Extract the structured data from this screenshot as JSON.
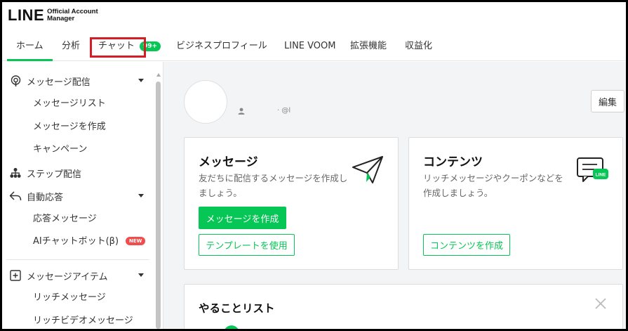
{
  "header": {
    "logo": "LINE",
    "logo_sub_1": "Official Account",
    "logo_sub_2": "Manager"
  },
  "tabs": [
    {
      "label": "ホーム",
      "active": true
    },
    {
      "label": "分析"
    },
    {
      "label": "チャット",
      "badge": "99+"
    },
    {
      "label": "ビジネスプロフィール"
    },
    {
      "label": "LINE VOOM"
    },
    {
      "label": "拡張機能"
    },
    {
      "label": "収益化"
    }
  ],
  "sidebar": {
    "broadcast": {
      "label": "メッセージ配信",
      "items": [
        "メッセージリスト",
        "メッセージを作成",
        "キャンペーン"
      ]
    },
    "step": {
      "label": "ステップ配信"
    },
    "auto_reply": {
      "label": "自動応答",
      "items": [
        "応答メッセージ",
        "AIチャットボット(β)"
      ],
      "new_badge": "NEW"
    },
    "message_items": {
      "label": "メッセージアイテム",
      "items": [
        "リッチメッセージ",
        "リッチビデオメッセージ"
      ]
    }
  },
  "profile": {
    "account_text": "· @l",
    "edit_label": "編集"
  },
  "cards": {
    "message": {
      "title": "メッセージ",
      "desc": "友だちに配信するメッセージを作成しましょう。",
      "primary_btn": "メッセージを作成",
      "secondary_btn": "テンプレートを使用"
    },
    "content": {
      "title": "コンテンツ",
      "desc": "リッチメッセージやクーポンなどを作成しましょう。",
      "btn": "コンテンツを作成",
      "icon_text": "LINE"
    },
    "todo": {
      "title": "やることリスト"
    }
  },
  "colors": {
    "line_green": "#06c755",
    "highlight_red": "#d21f26",
    "new_red": "#f04e4e"
  }
}
